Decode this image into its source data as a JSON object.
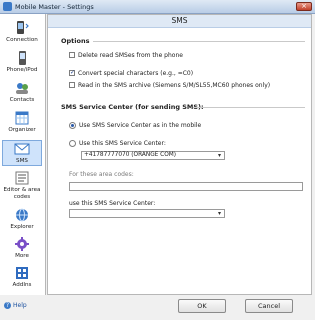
{
  "window": {
    "title": "Mobile Master - Settings",
    "close_glyph": "×",
    "icon": "app-icon"
  },
  "sidebar": {
    "items": [
      {
        "label": "Connection",
        "icon": "connection-icon"
      },
      {
        "label": "Phone/iPod",
        "icon": "phone-icon"
      },
      {
        "label": "Contacts",
        "icon": "contacts-icon"
      },
      {
        "label": "Organizer",
        "icon": "calendar-icon"
      },
      {
        "label": "SMS",
        "icon": "envelope-icon",
        "selected": true
      },
      {
        "label": "Editor & area codes",
        "icon": "editor-icon"
      },
      {
        "label": "Explorer",
        "icon": "globe-icon"
      },
      {
        "label": "More",
        "icon": "gear-icon"
      },
      {
        "label": "AddIns",
        "icon": "addins-icon"
      }
    ]
  },
  "main": {
    "section_title": "SMS",
    "options": {
      "title": "Options",
      "checkboxes": [
        {
          "label": "Delete read SMSes from the phone",
          "checked": false
        },
        {
          "label": "Convert special characters (e.g., =C0)",
          "checked": true
        },
        {
          "label": "Read in the SMS archive (Siemens S/M/SL55,MC60 phones only)",
          "checked": false
        }
      ]
    },
    "sms_center": {
      "title": "SMS Service Center (for sending SMS):",
      "radio_mobile": "Use SMS Service Center as in the mobile",
      "radio_this": "Use this SMS Service Center:",
      "selected": "mobile",
      "center_value": "+41787777070 (ORANGE COM)",
      "area_codes_label": "For these area codes:",
      "area_codes_value": "",
      "use_center_label": "use this SMS Service Center:",
      "use_center_value": ""
    }
  },
  "footer": {
    "help_label": "Help",
    "ok_label": "OK",
    "cancel_label": "Cancel"
  },
  "colors": {
    "selection": "#cfe3fb",
    "title_bar": "#b9cde6",
    "close_button": "#c2402b"
  }
}
